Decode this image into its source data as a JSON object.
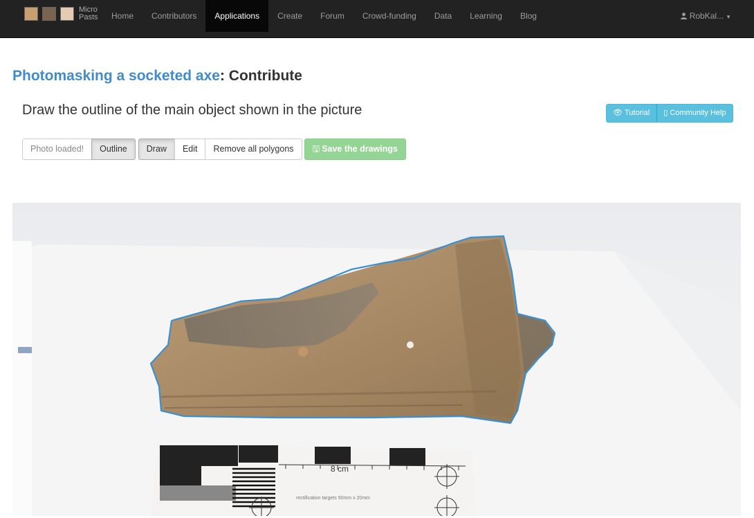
{
  "brand": {
    "line1": "Micro",
    "line2": "Pasts"
  },
  "nav": {
    "items": [
      {
        "label": "Home",
        "active": false
      },
      {
        "label": "Contributors",
        "active": false
      },
      {
        "label": "Applications",
        "active": true
      },
      {
        "label": "Create",
        "active": false
      },
      {
        "label": "Forum",
        "active": false
      },
      {
        "label": "Crowd-funding",
        "active": false
      },
      {
        "label": "Data",
        "active": false
      },
      {
        "label": "Learning",
        "active": false
      },
      {
        "label": "Blog",
        "active": false
      }
    ],
    "user": {
      "icon": "user-icon",
      "name": "RobKal..."
    }
  },
  "header": {
    "project": "Photomasking a socketed axe",
    "separator": ":",
    "suffix": "Contribute",
    "instruction": "Draw the outline of the main object shown in the picture"
  },
  "help": {
    "tutorial": {
      "icon": "eye-icon",
      "label": "Tutorial"
    },
    "community": {
      "icon": "book-icon",
      "label": "Community Help"
    }
  },
  "toolbar": {
    "status": "Photo loaded!",
    "outline": "Outline",
    "draw": "Draw",
    "edit": "Edit",
    "remove": "Remove all polygons",
    "save": {
      "icon": "floppy-icon",
      "label": "Save the drawings"
    }
  },
  "photo": {
    "scale_label": "8 cm",
    "scale_caption": "rectification targets 50mm x 20mm",
    "outline_color": "#3a8fd0"
  },
  "colors": {
    "accent": "#428bca",
    "navbar": "#222222",
    "info": "#5bc0de",
    "success": "#94d494"
  }
}
